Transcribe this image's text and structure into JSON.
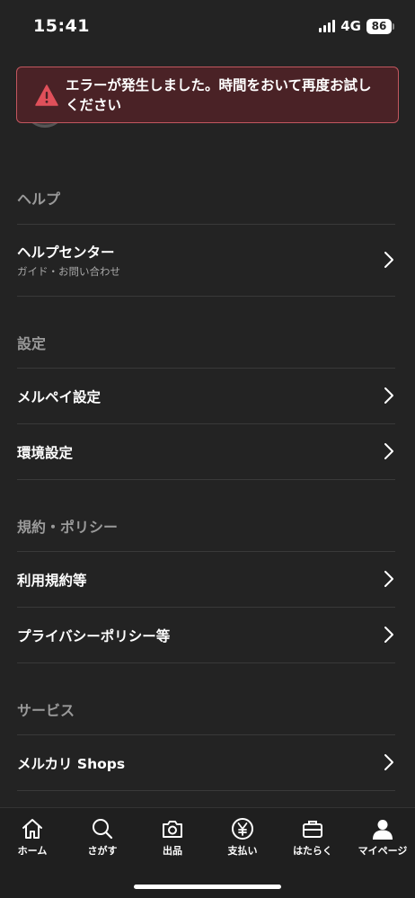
{
  "status_bar": {
    "time": "15:41",
    "network": "4G",
    "battery": "86"
  },
  "error_toast": {
    "message": "エラーが発生しました。時間をおいて再度お試しください",
    "icon": "warning-icon",
    "colors": {
      "background": "#4a2226",
      "border": "#c2575f",
      "icon": "#e0505a"
    }
  },
  "sections": {
    "help": {
      "title": "ヘルプ",
      "items": [
        {
          "label": "ヘルプセンター",
          "sublabel": "ガイド・お問い合わせ"
        }
      ]
    },
    "settings": {
      "title": "設定",
      "items": [
        {
          "label": "メルペイ設定"
        },
        {
          "label": "環境設定"
        }
      ]
    },
    "policy": {
      "title": "規約・ポリシー",
      "items": [
        {
          "label": "利用規約等"
        },
        {
          "label": "プライバシーポリシー等"
        }
      ]
    },
    "services": {
      "title": "サービス",
      "items": [
        {
          "label": "メルカリ Shops"
        }
      ]
    }
  },
  "tab_bar": {
    "tabs": [
      {
        "label": "ホーム",
        "icon": "home-icon"
      },
      {
        "label": "さがす",
        "icon": "search-icon"
      },
      {
        "label": "出品",
        "icon": "camera-icon"
      },
      {
        "label": "支払い",
        "icon": "yen-icon"
      },
      {
        "label": "はたらく",
        "icon": "briefcase-icon"
      },
      {
        "label": "マイページ",
        "icon": "person-icon",
        "active": true
      }
    ]
  }
}
